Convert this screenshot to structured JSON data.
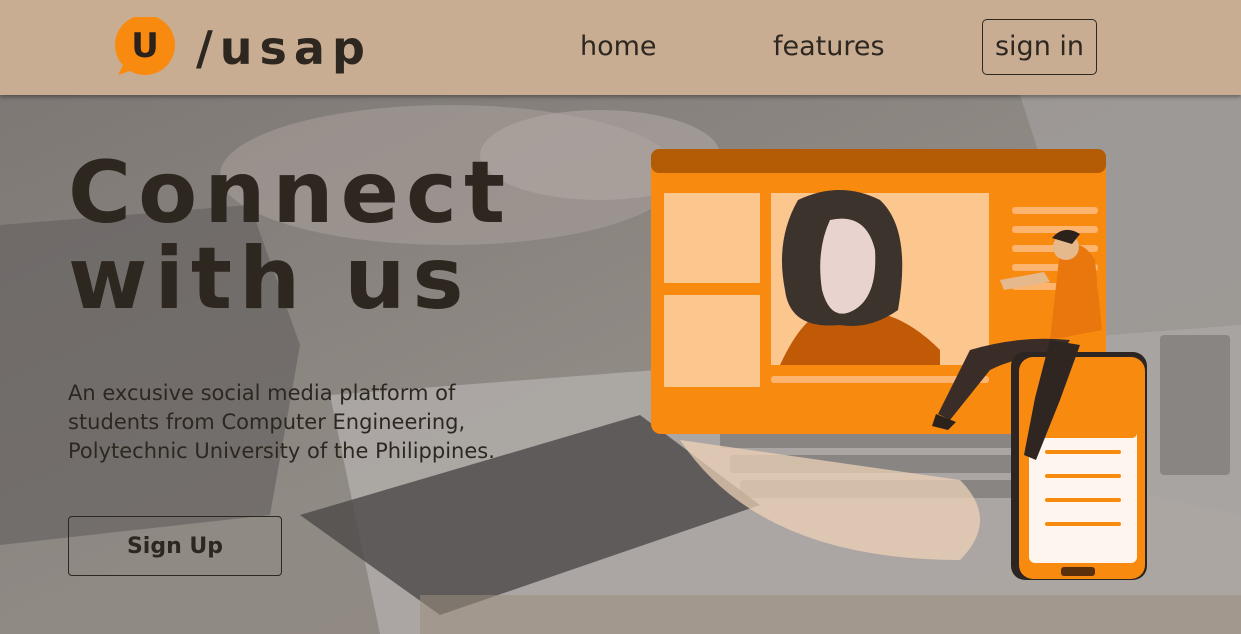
{
  "header": {
    "logo_letter": "U",
    "brand": "/usap",
    "nav": {
      "home": "home",
      "features": "features",
      "signin": "sign in"
    }
  },
  "hero": {
    "headline_line1": "Connect",
    "headline_line2": "with us",
    "tagline_line1": "An excusive social media platform of",
    "tagline_line2": "students from Computer Engineering,",
    "tagline_line3": "Polytechnic University of the Philippines.",
    "signup_label": "Sign Up"
  },
  "colors": {
    "header_bg": "#c8ad93",
    "text_dark": "#2e2720",
    "accent_orange": "#f98a10",
    "light_peach": "#fcc68f"
  },
  "icons": [
    "speech-bubble-logo-icon",
    "video-call-illustration"
  ]
}
